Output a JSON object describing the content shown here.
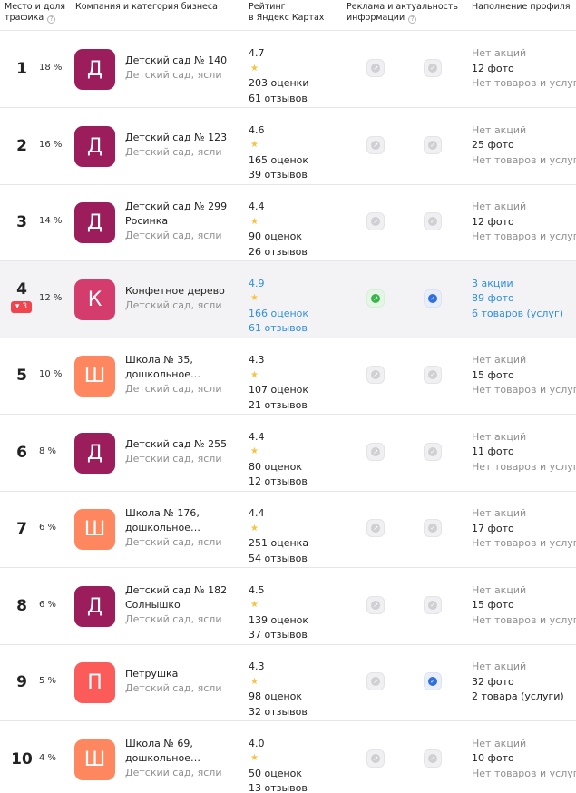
{
  "header": {
    "place_line1": "Место и доля",
    "place_line2": "трафика",
    "company": "Компания и категория бизнеса",
    "rating_line1": "Рейтинг",
    "rating_line2": "в Яндекс Картах",
    "ads_line1": "Реклама и актуальность",
    "ads_line2": "информации",
    "profile": "Наполнение профиля",
    "help_glyph": "?"
  },
  "icons": {
    "star": "★",
    "ad_glyph": "↗",
    "check_glyph": "✓",
    "down_arrow": "▾"
  },
  "colors": {
    "avatar_d": "#9b1d5c",
    "avatar_sh": "#ff875f",
    "avatar_p": "#fb5c59",
    "avatar_k": "#d43c6e",
    "highlight_link": "#2f8fdc",
    "delta_red": "#f0444e"
  },
  "rows": [
    {
      "rank": "1",
      "share": "18 %",
      "letter": "Д",
      "name": "Детский сад № 140",
      "name2": "",
      "category": "Детский сад, ясли",
      "rating": "4.7",
      "ratings_count": "203 оценки",
      "reviews": "61 отзывов",
      "promos": "Нет акций",
      "photos": "12 фото",
      "goods": "Нет товаров и услуг"
    },
    {
      "rank": "2",
      "share": "16 %",
      "letter": "Д",
      "name": "Детский сад № 123",
      "name2": "",
      "category": "Детский сад, ясли",
      "rating": "4.6",
      "ratings_count": "165 оценок",
      "reviews": "39 отзывов",
      "promos": "Нет акций",
      "photos": "25 фото",
      "goods": "Нет товаров и услуг"
    },
    {
      "rank": "3",
      "share": "14 %",
      "letter": "Д",
      "name": "Детский сад № 299",
      "name2": "Росинка",
      "category": "Детский сад, ясли",
      "rating": "4.4",
      "ratings_count": "90 оценок",
      "reviews": "26 отзывов",
      "promos": "Нет акций",
      "photos": "12 фото",
      "goods": "Нет товаров и услуг"
    },
    {
      "rank": "4",
      "share": "12 %",
      "delta": "3",
      "letter": "К",
      "name": "Конфетное дерево",
      "name2": "",
      "category": "Детский сад, ясли",
      "rating": "4.9",
      "ratings_count": "166 оценок",
      "reviews": "61 отзывов",
      "promos": "3 акции",
      "photos": "89 фото",
      "goods": "6 товаров (услуг)"
    },
    {
      "rank": "5",
      "share": "10 %",
      "letter": "Ш",
      "name": "Школа № 35,",
      "name2": "дошкольное…",
      "category": "Детский сад, ясли",
      "rating": "4.3",
      "ratings_count": "107 оценок",
      "reviews": "21 отзывов",
      "promos": "Нет акций",
      "photos": "15 фото",
      "goods": "Нет товаров и услуг"
    },
    {
      "rank": "6",
      "share": "8 %",
      "letter": "Д",
      "name": "Детский сад № 255",
      "name2": "",
      "category": "Детский сад, ясли",
      "rating": "4.4",
      "ratings_count": "80 оценок",
      "reviews": "12 отзывов",
      "promos": "Нет акций",
      "photos": "11 фото",
      "goods": "Нет товаров и услуг"
    },
    {
      "rank": "7",
      "share": "6 %",
      "letter": "Ш",
      "name": "Школа № 176,",
      "name2": "дошкольное…",
      "category": "Детский сад, ясли",
      "rating": "4.4",
      "ratings_count": "251 оценка",
      "reviews": "54 отзывов",
      "promos": "Нет акций",
      "photos": "17 фото",
      "goods": "Нет товаров и услуг"
    },
    {
      "rank": "8",
      "share": "6 %",
      "letter": "Д",
      "name": "Детский сад № 182",
      "name2": "Солнышко",
      "category": "Детский сад, ясли",
      "rating": "4.5",
      "ratings_count": "139 оценок",
      "reviews": "37 отзывов",
      "promos": "Нет акций",
      "photos": "15 фото",
      "goods": "Нет товаров и услуг"
    },
    {
      "rank": "9",
      "share": "5 %",
      "letter": "П",
      "name": "Петрушка",
      "name2": "",
      "category": "Детский сад, ясли",
      "rating": "4.3",
      "ratings_count": "98 оценок",
      "reviews": "32 отзывов",
      "promos": "Нет акций",
      "photos": "32 фото",
      "goods": "2 товара (услуги)"
    },
    {
      "rank": "10",
      "share": "4 %",
      "letter": "Ш",
      "name": "Школа № 69,",
      "name2": "дошкольное…",
      "category": "Детский сад, ясли",
      "rating": "4.0",
      "ratings_count": "50 оценок",
      "reviews": "13 отзывов",
      "promos": "Нет акций",
      "photos": "10 фото",
      "goods": "Нет товаров и услуг"
    }
  ]
}
